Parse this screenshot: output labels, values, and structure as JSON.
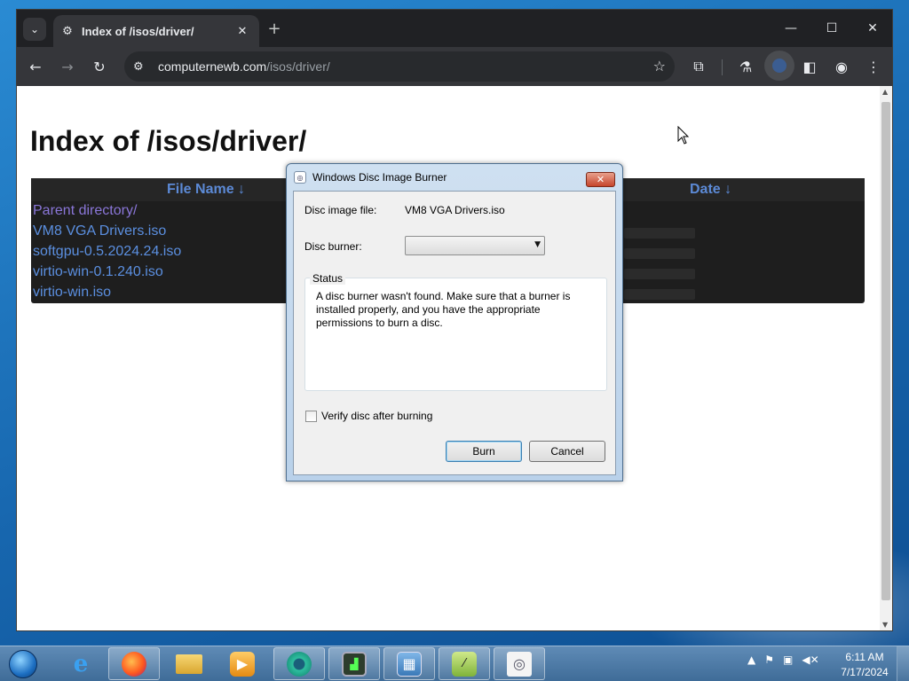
{
  "browser": {
    "tab_title": "Index of /isos/driver/",
    "tab_close": "✕",
    "new_tab": "+",
    "url_host": "computernewb.com",
    "url_path": "/isos/driver/",
    "window_controls": {
      "minimize": "—",
      "maximize": "☐",
      "close": "✕"
    }
  },
  "page": {
    "heading": "Index of /isos/driver/",
    "columns": {
      "file_name": "File Name  ↓",
      "date": "Date  ↓"
    },
    "rows": [
      {
        "name": "Parent directory/",
        "visited": true
      },
      {
        "name": "VM8 VGA Drivers.iso",
        "visited": false
      },
      {
        "name": "softgpu-0.5.2024.24.iso",
        "visited": false
      },
      {
        "name": "virtio-win-0.1.240.iso",
        "visited": false
      },
      {
        "name": "virtio-win.iso",
        "visited": false
      }
    ]
  },
  "dialog": {
    "title": "Windows Disc Image Burner",
    "disc_image_label": "Disc image file:",
    "disc_image_value": "VM8 VGA Drivers.iso",
    "burner_label": "Disc burner:",
    "burner_value": "",
    "status_legend": "Status",
    "status_text": "A disc burner wasn't found. Make sure that a burner is installed properly, and you have the appropriate permissions to burn a disc.",
    "verify_label": "Verify disc after burning",
    "verify_checked": false,
    "burn_button": "Burn",
    "cancel_button": "Cancel"
  },
  "taskbar": {
    "items": [
      "internet-explorer",
      "firefox",
      "file-explorer",
      "media-player",
      "chrome",
      "task-manager",
      "control-panel",
      "notepad-plus",
      "disc-burner"
    ],
    "clock_time": "6:11 AM",
    "clock_date": "7/17/2024"
  }
}
